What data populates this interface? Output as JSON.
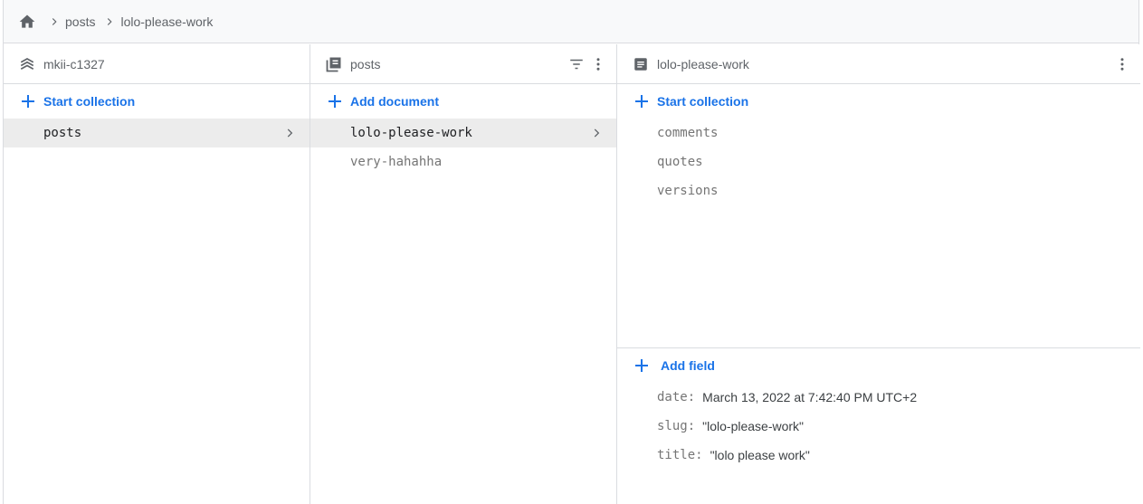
{
  "breadcrumb": {
    "home_icon": "home-icon",
    "items": [
      {
        "label": "posts"
      },
      {
        "label": "lolo-please-work"
      }
    ]
  },
  "columns": {
    "root": {
      "icon": "database-icon",
      "title": "mkii-c1327",
      "action_label": "Start collection",
      "items": [
        {
          "label": "posts",
          "selected": true
        }
      ]
    },
    "collection": {
      "icon": "collection-icon",
      "title": "posts",
      "action_label": "Add document",
      "items": [
        {
          "label": "lolo-please-work",
          "selected": true
        },
        {
          "label": "very-hahahha",
          "selected": false
        }
      ]
    },
    "document": {
      "icon": "document-icon",
      "title": "lolo-please-work",
      "action_label": "Start collection",
      "subcollections": [
        {
          "label": "comments"
        },
        {
          "label": "quotes"
        },
        {
          "label": "versions"
        }
      ],
      "add_field_label": "Add field",
      "fields": [
        {
          "key": "date:",
          "value": "March 13, 2022 at 7:42:40 PM UTC+2"
        },
        {
          "key": "slug:",
          "value": "\"lolo-please-work\""
        },
        {
          "key": "title:",
          "value": "\"lolo please work\""
        }
      ]
    }
  },
  "colors": {
    "accent": "#1a73e8",
    "selected_row": "#ececec",
    "border": "#dadce0",
    "breadcrumb_bg": "#f8f9fa"
  }
}
